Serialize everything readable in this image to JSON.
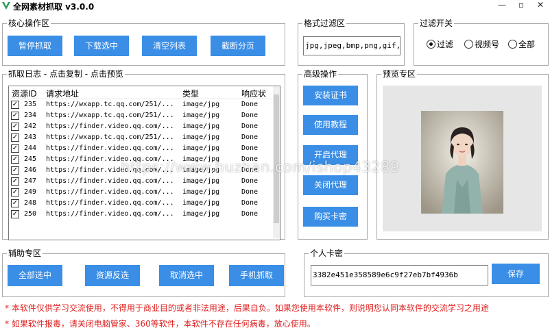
{
  "window": {
    "title": "全网素材抓取 v3.0.0",
    "minimize": "—",
    "maximize": "▫",
    "close": "✕"
  },
  "core": {
    "title": "核心操作区",
    "buttons": [
      "暂停抓取",
      "下载选中",
      "清空列表",
      "截断分页"
    ]
  },
  "format": {
    "title": "格式过滤区",
    "value": "jpg,jpeg,bmp,png,gif,mp"
  },
  "filter": {
    "title": "过滤开关",
    "options": [
      "过滤",
      "视频号",
      "全部"
    ],
    "selected": 0
  },
  "log": {
    "title": "抓取日志 - 点击复制 - 点击预览",
    "columns": [
      "资源ID",
      "请求地址",
      "类型",
      "响应状"
    ],
    "rows": [
      {
        "id": "235",
        "url": "https://wxapp.tc.qq.com/251/...",
        "type": "image/jpg",
        "status": "Done"
      },
      {
        "id": "234",
        "url": "https://wxapp.tc.qq.com/251/...",
        "type": "image/jpg",
        "status": "Done"
      },
      {
        "id": "242",
        "url": "https://finder.video.qq.com/...",
        "type": "image/jpg",
        "status": "Done"
      },
      {
        "id": "243",
        "url": "https://wxapp.tc.qq.com/251/...",
        "type": "image/jpg",
        "status": "Done"
      },
      {
        "id": "244",
        "url": "https://finder.video.qq.com/...",
        "type": "image/jpg",
        "status": "Done"
      },
      {
        "id": "245",
        "url": "https://finder.video.qq.com/...",
        "type": "image/jpg",
        "status": "Done"
      },
      {
        "id": "246",
        "url": "https://finder.video.qq.com/...",
        "type": "image/jpg",
        "status": "Done"
      },
      {
        "id": "247",
        "url": "https://finder.video.qq.com/...",
        "type": "image/jpg",
        "status": "Done"
      },
      {
        "id": "249",
        "url": "https://finder.video.qq.com/...",
        "type": "image/jpg",
        "status": "Done"
      },
      {
        "id": "248",
        "url": "https://finder.video.qq.com/...",
        "type": "image/jpg",
        "status": "Done"
      },
      {
        "id": "250",
        "url": "https://finder.video.qq.com/...",
        "type": "image/jpg",
        "status": "Done"
      }
    ]
  },
  "advanced": {
    "title": "高级操作",
    "buttons": [
      "安装证书",
      "使用教程",
      "开启代理",
      "关闭代理",
      "购买卡密"
    ]
  },
  "preview": {
    "title": "预览专区"
  },
  "aux": {
    "title": "辅助专区",
    "buttons": [
      "全部选中",
      "资源反选",
      "取消选中",
      "手机抓取"
    ]
  },
  "card": {
    "title": "个人卡密",
    "value": "3382e451e358589e6c9f27eb7bf4936b",
    "save": "保存"
  },
  "notes": [
    "* 本软件仅供学习交流使用，不得用于商业目的或者非法用途，后果自负。如果您使用本软件，则说明您认同本软件的交流学习之用途",
    "* 如果软件报毒，请关闭电脑管家、360等软件，本软件不存在任何病毒，放心使用。"
  ],
  "watermark": "https://www.huzhan.com/ishop43289",
  "colors": {
    "button": "#3a8ee6",
    "note": "#e02020",
    "logo": "#2e9a5a"
  }
}
